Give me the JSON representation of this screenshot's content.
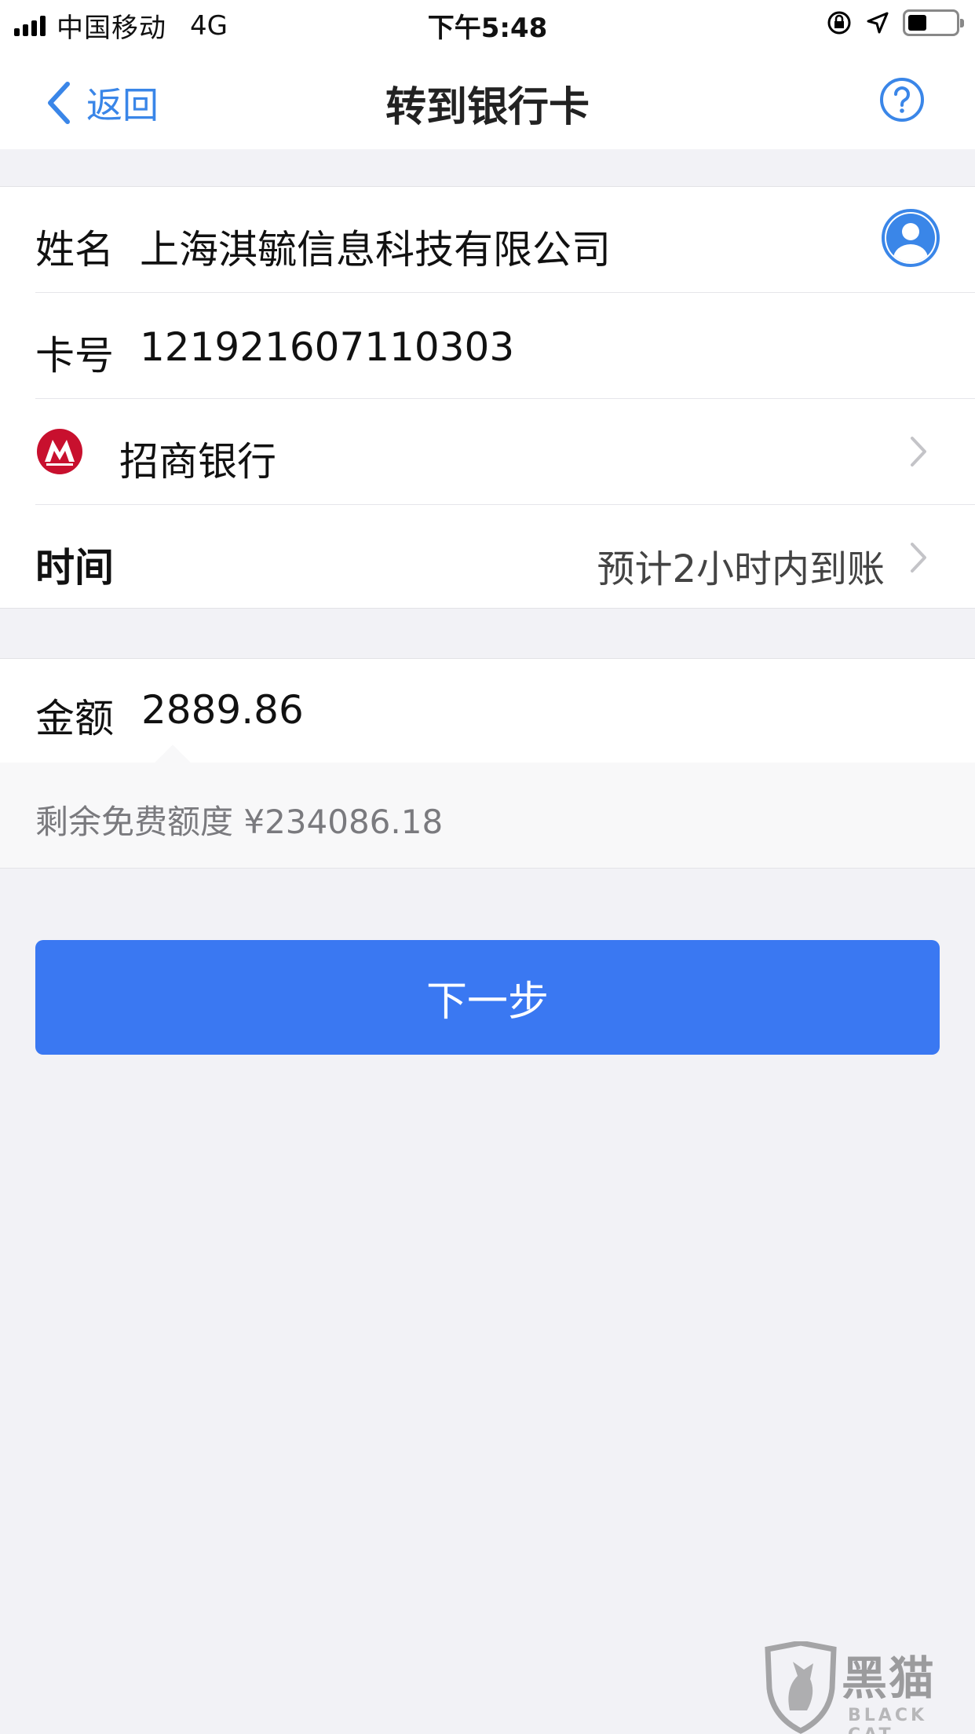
{
  "status_bar": {
    "carrier": "中国移动",
    "network": "4G",
    "time": "下午5:48",
    "battery_level": 0.4
  },
  "nav": {
    "back_label": "返回",
    "title": "转到银行卡",
    "help_icon": "question-circle-icon"
  },
  "payee": {
    "name_label": "姓名",
    "name_value": "上海淇毓信息科技有限公司",
    "contact_icon": "contact-person-icon",
    "card_label": "卡号",
    "card_value": "121921607110303",
    "bank_icon": "cmb-bank-logo",
    "bank_name": "招商银行",
    "time_label": "时间",
    "time_value": "预计2小时内到账"
  },
  "amount": {
    "label": "金额",
    "value": "2889.86",
    "quota_text": "剩余免费额度 ¥234086.18"
  },
  "next_button": "下一步",
  "colors": {
    "accent": "#3a86e8",
    "button": "#3a78f2",
    "bank_red": "#c8102e"
  },
  "watermark": {
    "text": "黑猫",
    "sub": "BLACK CAT"
  }
}
